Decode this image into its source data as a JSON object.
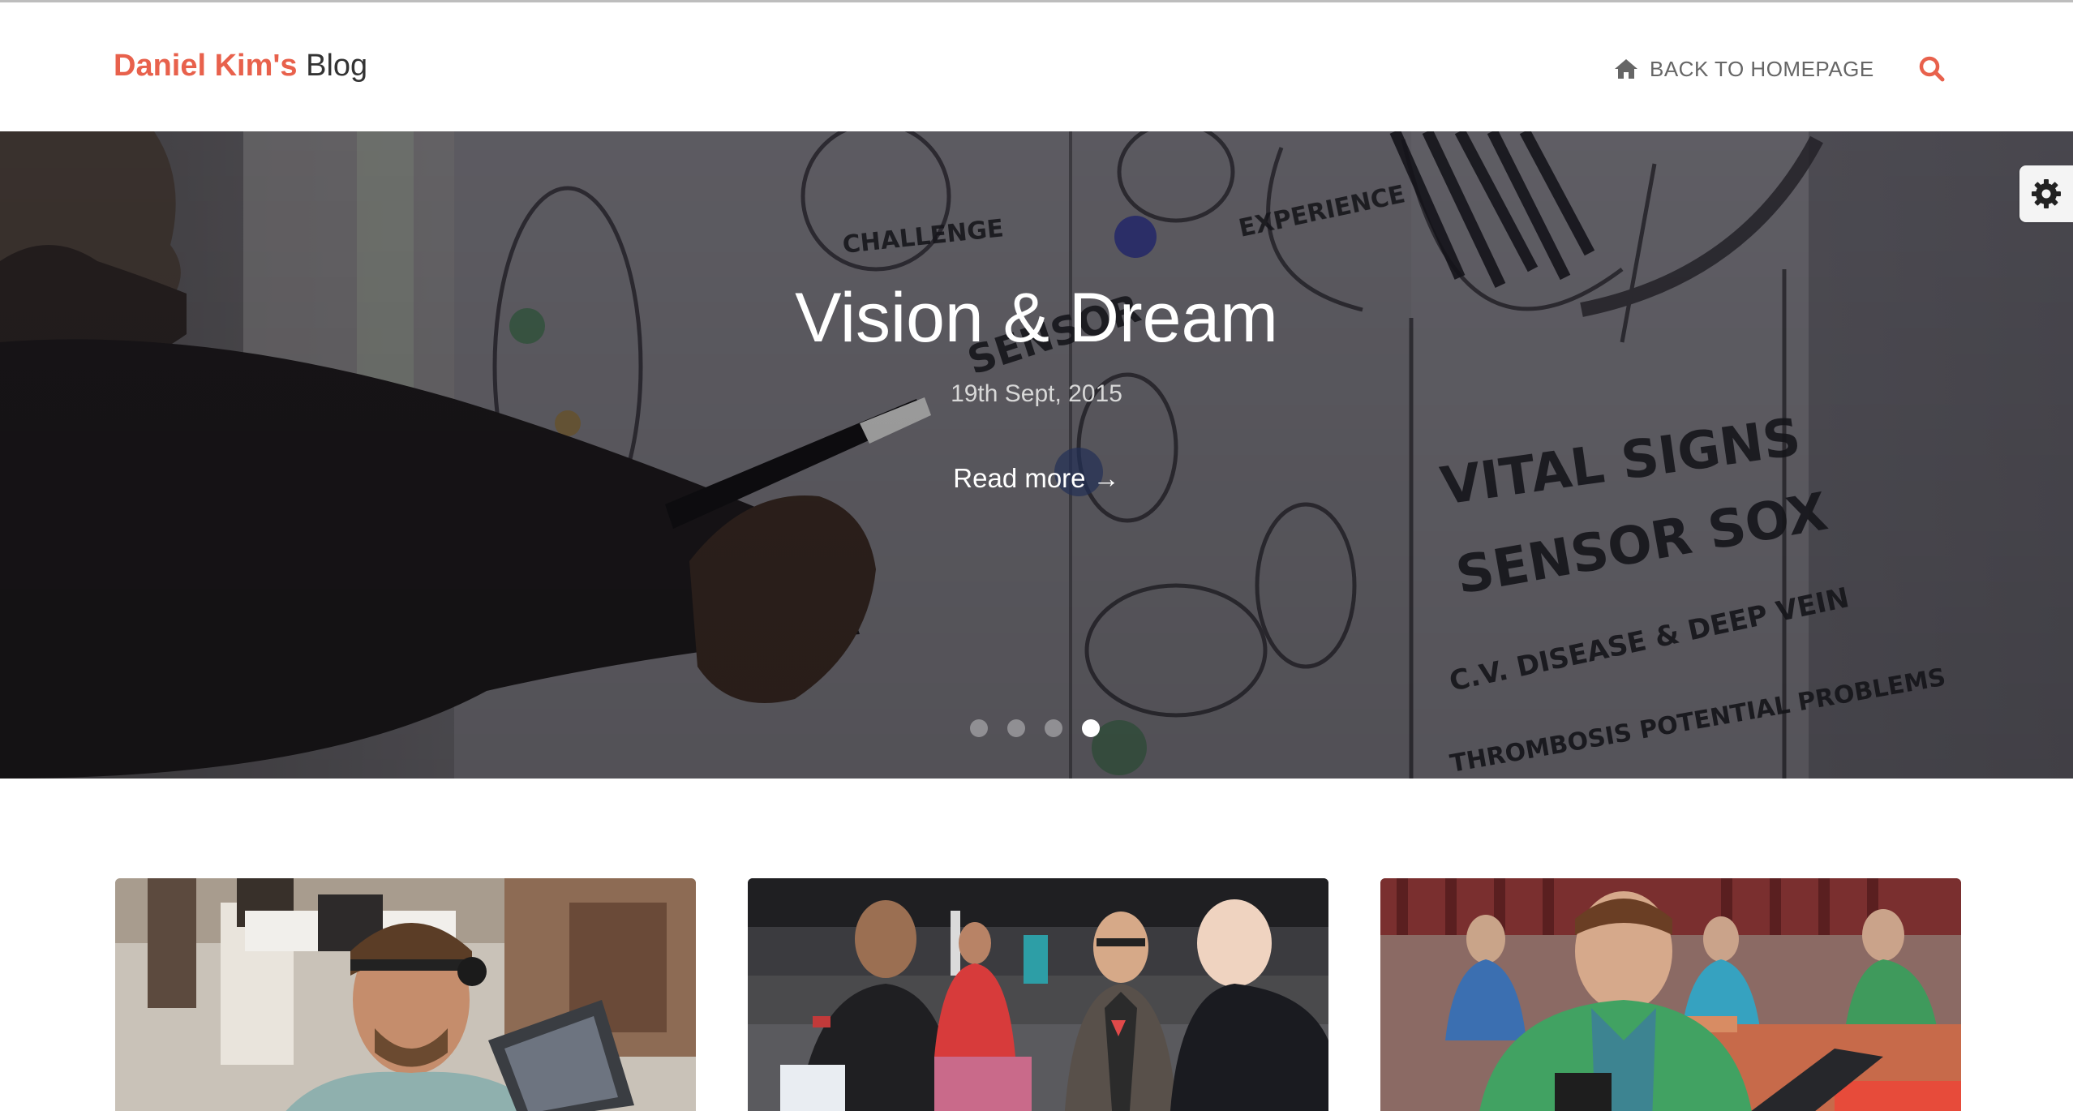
{
  "header": {
    "brand_accent": "Daniel Kim's",
    "brand_rest": "Blog",
    "nav_home_label": "BACK TO HOMEPAGE",
    "home_icon": "home-icon",
    "search_icon": "search-icon"
  },
  "hero": {
    "title": "Vision & Dream",
    "date": "19th Sept, 2015",
    "read_more": "Read more →",
    "slide_count": 4,
    "active_slide": 4,
    "whiteboard_text": [
      "VITAL SIGNS",
      "SENSOR SOX",
      "C.V. DISEASE & DEEP VEIN",
      "THROMBOSIS POTENTIAL PROBLEMS",
      "EXPERIENCE",
      "CHALLENGE",
      "SENSOR"
    ]
  },
  "settings": {
    "icon": "gear-icon"
  },
  "cards": [
    {
      "image": "photo-man-with-head-mounted-glasses"
    },
    {
      "image": "photo-people-talking-at-event"
    },
    {
      "image": "photo-man-with-laptop-lanyard"
    }
  ],
  "colors": {
    "accent": "#e8614c",
    "text": "#333333",
    "nav": "#666666"
  }
}
